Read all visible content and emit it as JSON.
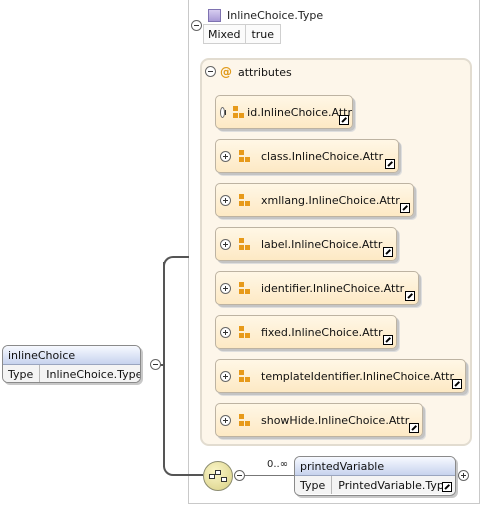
{
  "type": {
    "title": "InlineChoice.Type",
    "prop_key": "Mixed",
    "prop_value": "true"
  },
  "attributes": {
    "label": "attributes",
    "items": [
      "id.InlineChoice.Attr",
      "class.InlineChoice.Attr",
      "xmllang.InlineChoice.Attr",
      "label.InlineChoice.Attr",
      "identifier.InlineChoice.Attr",
      "fixed.InlineChoice.Attr",
      "templateIdentifier.InlineChoice.Attr",
      "showHide.InlineChoice.Attr"
    ]
  },
  "root": {
    "name": "inlineChoice",
    "type_key": "Type",
    "type_value": "InlineChoice.Type"
  },
  "sequence": {
    "cardinality": "0..∞"
  },
  "printed": {
    "name": "printedVariable",
    "type_key": "Type",
    "type_value": "PrintedVariable.Type"
  }
}
